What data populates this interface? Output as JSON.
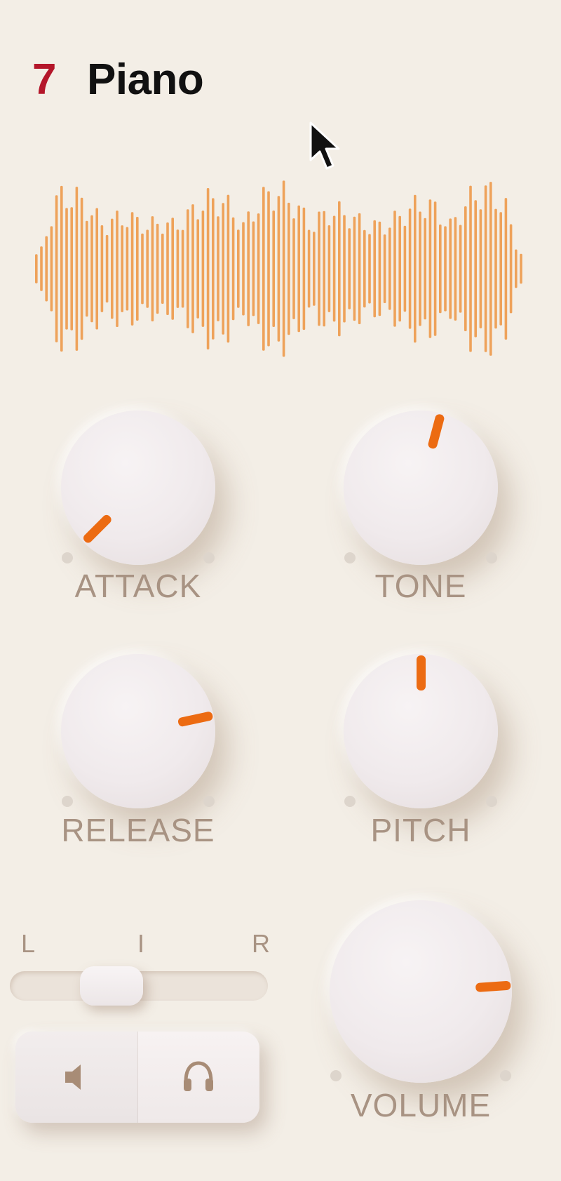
{
  "header": {
    "track_number": "7",
    "track_name": "Piano"
  },
  "colors": {
    "accent": "#ec6b12",
    "track_number": "#b4162a",
    "waveform": "#eea25a",
    "label": "#a89383",
    "background": "#f3eee6"
  },
  "knobs": [
    {
      "id": "attack",
      "label": "ATTACK",
      "angle_deg": -135
    },
    {
      "id": "tone",
      "label": "TONE",
      "angle_deg": 15
    },
    {
      "id": "release",
      "label": "RELEASE",
      "angle_deg": 78
    },
    {
      "id": "pitch",
      "label": "PITCH",
      "angle_deg": 0
    },
    {
      "id": "volume",
      "label": "VOLUME",
      "angle_deg": 86
    }
  ],
  "pan": {
    "left_label": "L",
    "center_label": "I",
    "right_label": "R",
    "value": 0.33
  },
  "monitor_buttons": [
    {
      "name": "speaker",
      "icon": "speaker-icon"
    },
    {
      "name": "headphones",
      "icon": "headphones-icon"
    }
  ],
  "cursor_icon": "arrow-cursor-icon",
  "waveform_icon": "audio-waveform"
}
